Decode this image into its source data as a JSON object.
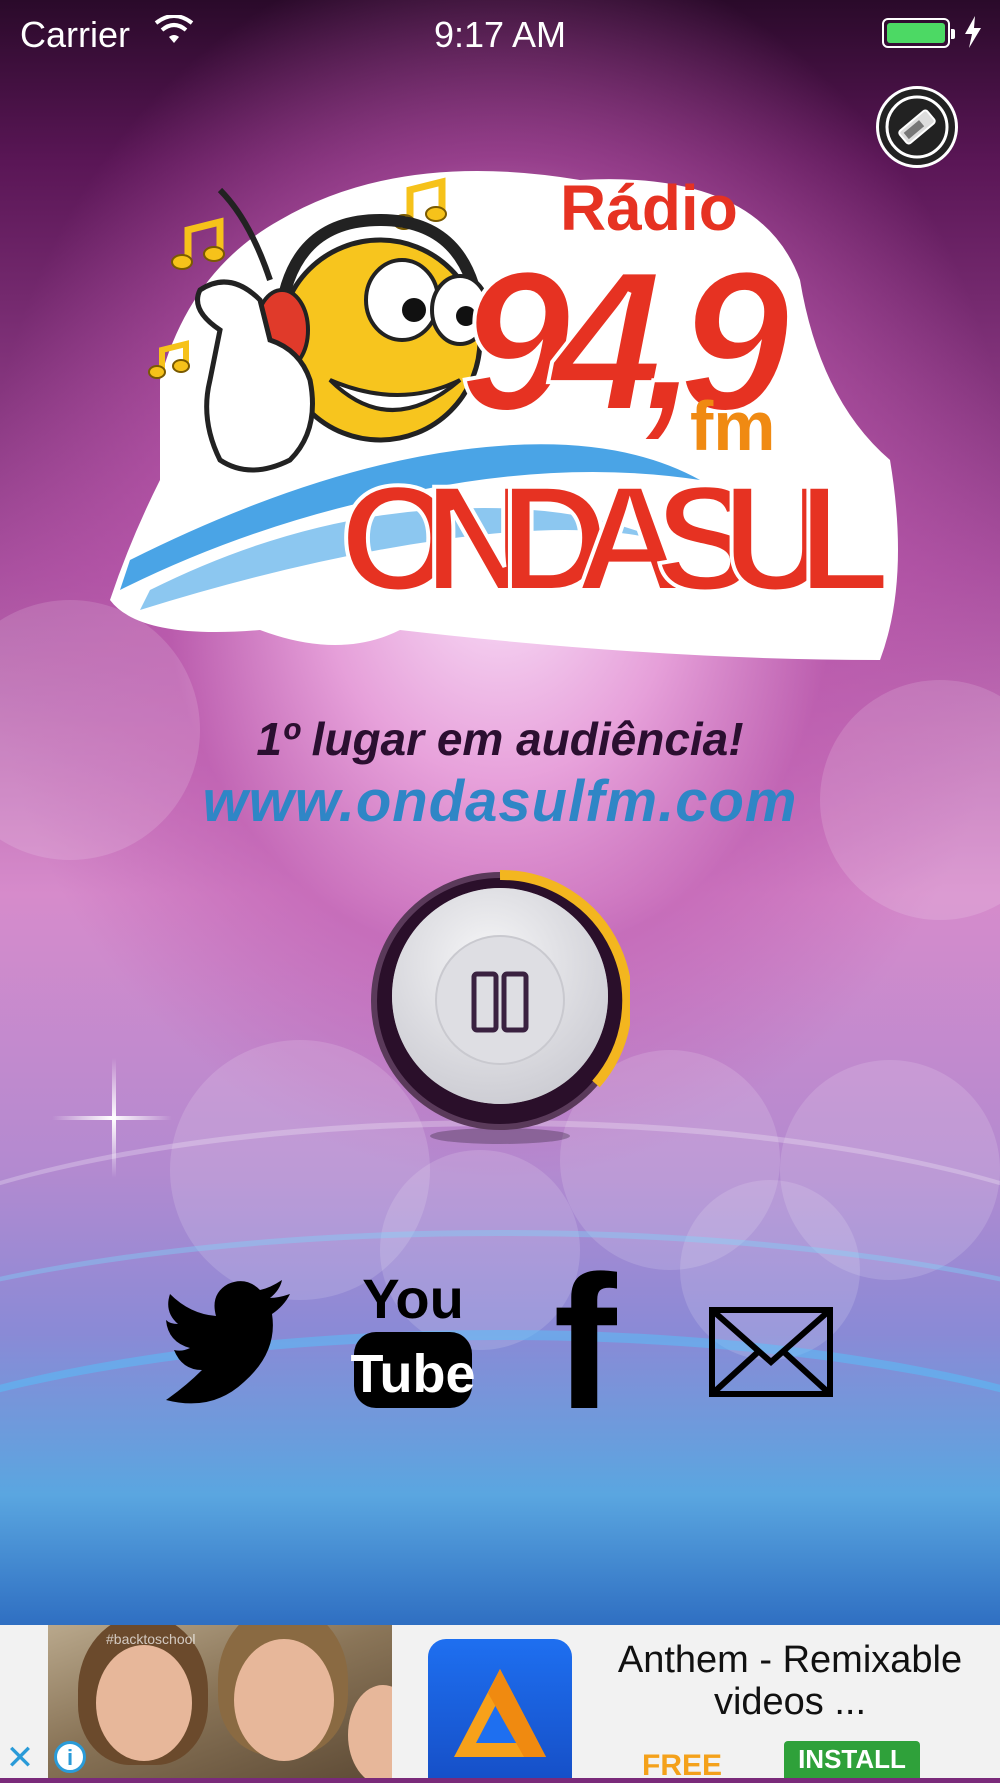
{
  "status_bar": {
    "carrier": "Carrier",
    "time": "9:17 AM",
    "battery_color": "#4cd964"
  },
  "logo": {
    "radio_word": "Rádio",
    "frequency": "94,9",
    "band": "fm",
    "station_name": "ONDA SUL",
    "mascot_icon": "smiley-headphones-thumbs-up"
  },
  "tagline": "1º lugar em audiência!",
  "website": "www.ondasulfm.com",
  "player": {
    "state_icon": "pause-icon",
    "progress_fraction": 0.3,
    "ring_color": "#f3b61f"
  },
  "social": {
    "twitter_icon": "twitter-bird-icon",
    "youtube": {
      "line1": "You",
      "line2": "Tube"
    },
    "facebook_glyph": "f",
    "mail_icon": "envelope-icon"
  },
  "ad": {
    "app_title": "Anthem - Remixable videos ...",
    "price": "FREE",
    "cta": "INSTALL",
    "close_glyph": "✕",
    "info_glyph": "i",
    "price_color": "#f4a11b",
    "cta_color": "#2fa13a"
  }
}
